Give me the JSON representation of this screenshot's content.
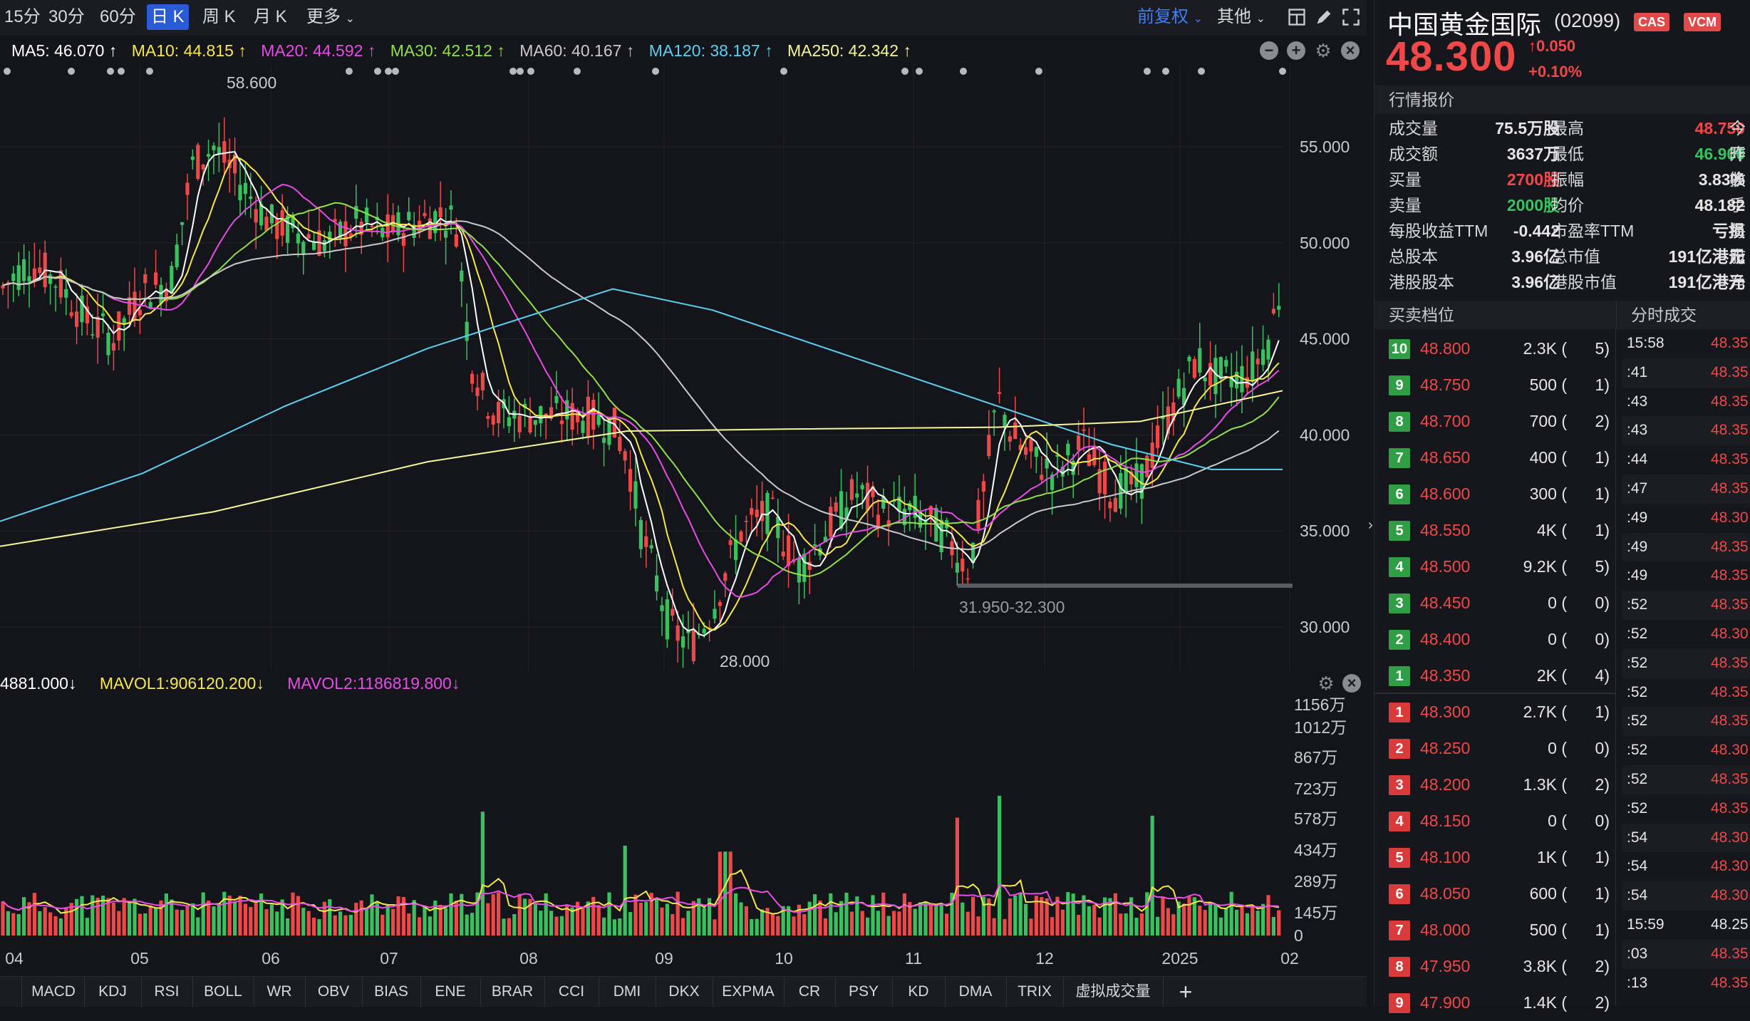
{
  "toolbar": {
    "periods": [
      "15分",
      "30分",
      "60分",
      "日 K",
      "周 K",
      "月 K",
      "更多"
    ],
    "active_period": "日 K",
    "adjust_label": "前复权",
    "other_label": "其他"
  },
  "ma_bar": {
    "ma5": "MA5: 46.070 ↑",
    "ma10": "MA10: 44.815 ↑",
    "ma20": "MA20: 44.592 ↑",
    "ma30": "MA30: 42.512 ↑",
    "ma60": "MA60: 40.167 ↑",
    "ma120": "MA120: 38.187 ↑",
    "ma250": "MA250: 42.342 ↑"
  },
  "colors": {
    "up": "#f04848",
    "down": "#39c15f",
    "ma5": "#ffffff",
    "ma10": "#f6e84a",
    "ma20": "#e64ce6",
    "ma30": "#8fe04a",
    "ma60": "#c9c9c9",
    "ma120": "#5bd0f0",
    "ma250": "#f5f59a"
  },
  "price_axis": {
    "labels": [
      "55.000",
      "50.000",
      "45.000",
      "40.000",
      "35.000",
      "30.000"
    ],
    "values": [
      55,
      50,
      45,
      40,
      35,
      30
    ],
    "high_label": "58.600",
    "low_label": "28.000",
    "range_label": "31.950-32.300"
  },
  "vol_header": {
    "vol": "4881.000↓",
    "mavol1": "MAVOL1:906120.200↓",
    "mavol2": "MAVOL2:1186819.800↓"
  },
  "vol_axis": {
    "labels": [
      "1156万",
      "1012万",
      "867万",
      "723万",
      "578万",
      "434万",
      "289万",
      "145万",
      "0"
    ]
  },
  "date_axis": [
    "04",
    "05",
    "06",
    "07",
    "08",
    "09",
    "10",
    "11",
    "12",
    "2025",
    "02"
  ],
  "indicator_tabs": [
    "MACD",
    "KDJ",
    "RSI",
    "BOLL",
    "WR",
    "OBV",
    "BIAS",
    "ENE",
    "BRAR",
    "CCI",
    "DMI",
    "DKX",
    "EXPMA",
    "CR",
    "PSY",
    "KD",
    "DMA",
    "TRIX",
    "虚拟成交量"
  ],
  "stock": {
    "name": "中国黄金国际",
    "code": "(02099)",
    "badge1": "CAS",
    "badge2": "VCM",
    "price": "48.300",
    "change": "0.050",
    "change_pct": "+0.10%"
  },
  "quote_section_title": "行情报价",
  "quote": [
    {
      "l1": "成交量",
      "v1": "75.5万股",
      "c1": "white",
      "l2": "最高",
      "v2": "48.750",
      "c2": "red",
      "l3": "今开"
    },
    {
      "l1": "成交额",
      "v1": "3637万",
      "c1": "white",
      "l2": "最低",
      "v2": "46.900",
      "c2": "green",
      "l3": "昨收"
    },
    {
      "l1": "买量",
      "v1": "2700股",
      "c1": "red",
      "l2": "振幅",
      "v2": "3.83%",
      "c2": "white",
      "l3": "换手"
    },
    {
      "l1": "卖量",
      "v1": "2000股",
      "c1": "green",
      "l2": "均价",
      "v2": "48.182",
      "c2": "white",
      "l3": ""
    },
    {
      "l1": "每股收益TTM",
      "v1": "-0.442",
      "c1": "white",
      "l2": "市盈率TTM",
      "v2": "亏损",
      "c2": "white",
      "l3": "每股"
    },
    {
      "l1": "总股本",
      "v1": "3.96亿",
      "c1": "white",
      "l2": "总市值",
      "v2": "191亿港元",
      "c2": "white",
      "l3": "市净"
    },
    {
      "l1": "港股股本",
      "v1": "3.96亿",
      "c1": "white",
      "l2": "港股市值",
      "v2": "191亿港元",
      "c2": "white",
      "l3": ""
    }
  ],
  "orderbook_title": "买卖档位",
  "trades_title": "分时成交",
  "orderbook": [
    {
      "idx": "10",
      "price": "48.800",
      "vol": "2.3K (",
      "cnt": "5)",
      "side": "ask"
    },
    {
      "idx": "9",
      "price": "48.750",
      "vol": "500 (",
      "cnt": "1)",
      "side": "ask"
    },
    {
      "idx": "8",
      "price": "48.700",
      "vol": "700 (",
      "cnt": "2)",
      "side": "ask"
    },
    {
      "idx": "7",
      "price": "48.650",
      "vol": "400 (",
      "cnt": "1)",
      "side": "ask"
    },
    {
      "idx": "6",
      "price": "48.600",
      "vol": "300 (",
      "cnt": "1)",
      "side": "ask"
    },
    {
      "idx": "5",
      "price": "48.550",
      "vol": "4K (",
      "cnt": "1)",
      "side": "ask"
    },
    {
      "idx": "4",
      "price": "48.500",
      "vol": "9.2K (",
      "cnt": "5)",
      "side": "ask"
    },
    {
      "idx": "3",
      "price": "48.450",
      "vol": "0 (",
      "cnt": "0)",
      "side": "ask"
    },
    {
      "idx": "2",
      "price": "48.400",
      "vol": "0 (",
      "cnt": "0)",
      "side": "ask"
    },
    {
      "idx": "1",
      "price": "48.350",
      "vol": "2K (",
      "cnt": "4)",
      "side": "ask"
    },
    {
      "idx": "1",
      "price": "48.300",
      "vol": "2.7K (",
      "cnt": "1)",
      "side": "bid"
    },
    {
      "idx": "2",
      "price": "48.250",
      "vol": "0 (",
      "cnt": "0)",
      "side": "bid"
    },
    {
      "idx": "3",
      "price": "48.200",
      "vol": "1.3K (",
      "cnt": "2)",
      "side": "bid"
    },
    {
      "idx": "4",
      "price": "48.150",
      "vol": "0 (",
      "cnt": "0)",
      "side": "bid"
    },
    {
      "idx": "5",
      "price": "48.100",
      "vol": "1K (",
      "cnt": "1)",
      "side": "bid"
    },
    {
      "idx": "6",
      "price": "48.050",
      "vol": "600 (",
      "cnt": "1)",
      "side": "bid"
    },
    {
      "idx": "7",
      "price": "48.000",
      "vol": "500 (",
      "cnt": "1)",
      "side": "bid"
    },
    {
      "idx": "8",
      "price": "47.950",
      "vol": "3.8K (",
      "cnt": "2)",
      "side": "bid"
    },
    {
      "idx": "9",
      "price": "47.900",
      "vol": "1.4K (",
      "cnt": "2)",
      "side": "bid"
    }
  ],
  "trades": [
    {
      "time": "15:58",
      "price": "48.35",
      "c": "red"
    },
    {
      "time": ":41",
      "price": "48.35",
      "c": "red"
    },
    {
      "time": ":43",
      "price": "48.35",
      "c": "red"
    },
    {
      "time": ":43",
      "price": "48.35",
      "c": "red"
    },
    {
      "time": ":44",
      "price": "48.35",
      "c": "red"
    },
    {
      "time": ":47",
      "price": "48.35",
      "c": "red"
    },
    {
      "time": ":49",
      "price": "48.30",
      "c": "red"
    },
    {
      "time": ":49",
      "price": "48.35",
      "c": "red"
    },
    {
      "time": ":49",
      "price": "48.35",
      "c": "red"
    },
    {
      "time": ":52",
      "price": "48.35",
      "c": "red"
    },
    {
      "time": ":52",
      "price": "48.30",
      "c": "red"
    },
    {
      "time": ":52",
      "price": "48.35",
      "c": "red"
    },
    {
      "time": ":52",
      "price": "48.35",
      "c": "red"
    },
    {
      "time": ":52",
      "price": "48.35",
      "c": "red"
    },
    {
      "time": ":52",
      "price": "48.30",
      "c": "red"
    },
    {
      "time": ":52",
      "price": "48.35",
      "c": "red"
    },
    {
      "time": ":52",
      "price": "48.35",
      "c": "red"
    },
    {
      "time": ":54",
      "price": "48.30",
      "c": "red"
    },
    {
      "time": ":54",
      "price": "48.30",
      "c": "red"
    },
    {
      "time": ":54",
      "price": "48.30",
      "c": "red"
    },
    {
      "time": "15:59",
      "price": "48.25",
      "c": "white"
    },
    {
      "time": ":03",
      "price": "48.35",
      "c": "red"
    },
    {
      "time": ":13",
      "price": "48.35",
      "c": "red"
    }
  ]
}
